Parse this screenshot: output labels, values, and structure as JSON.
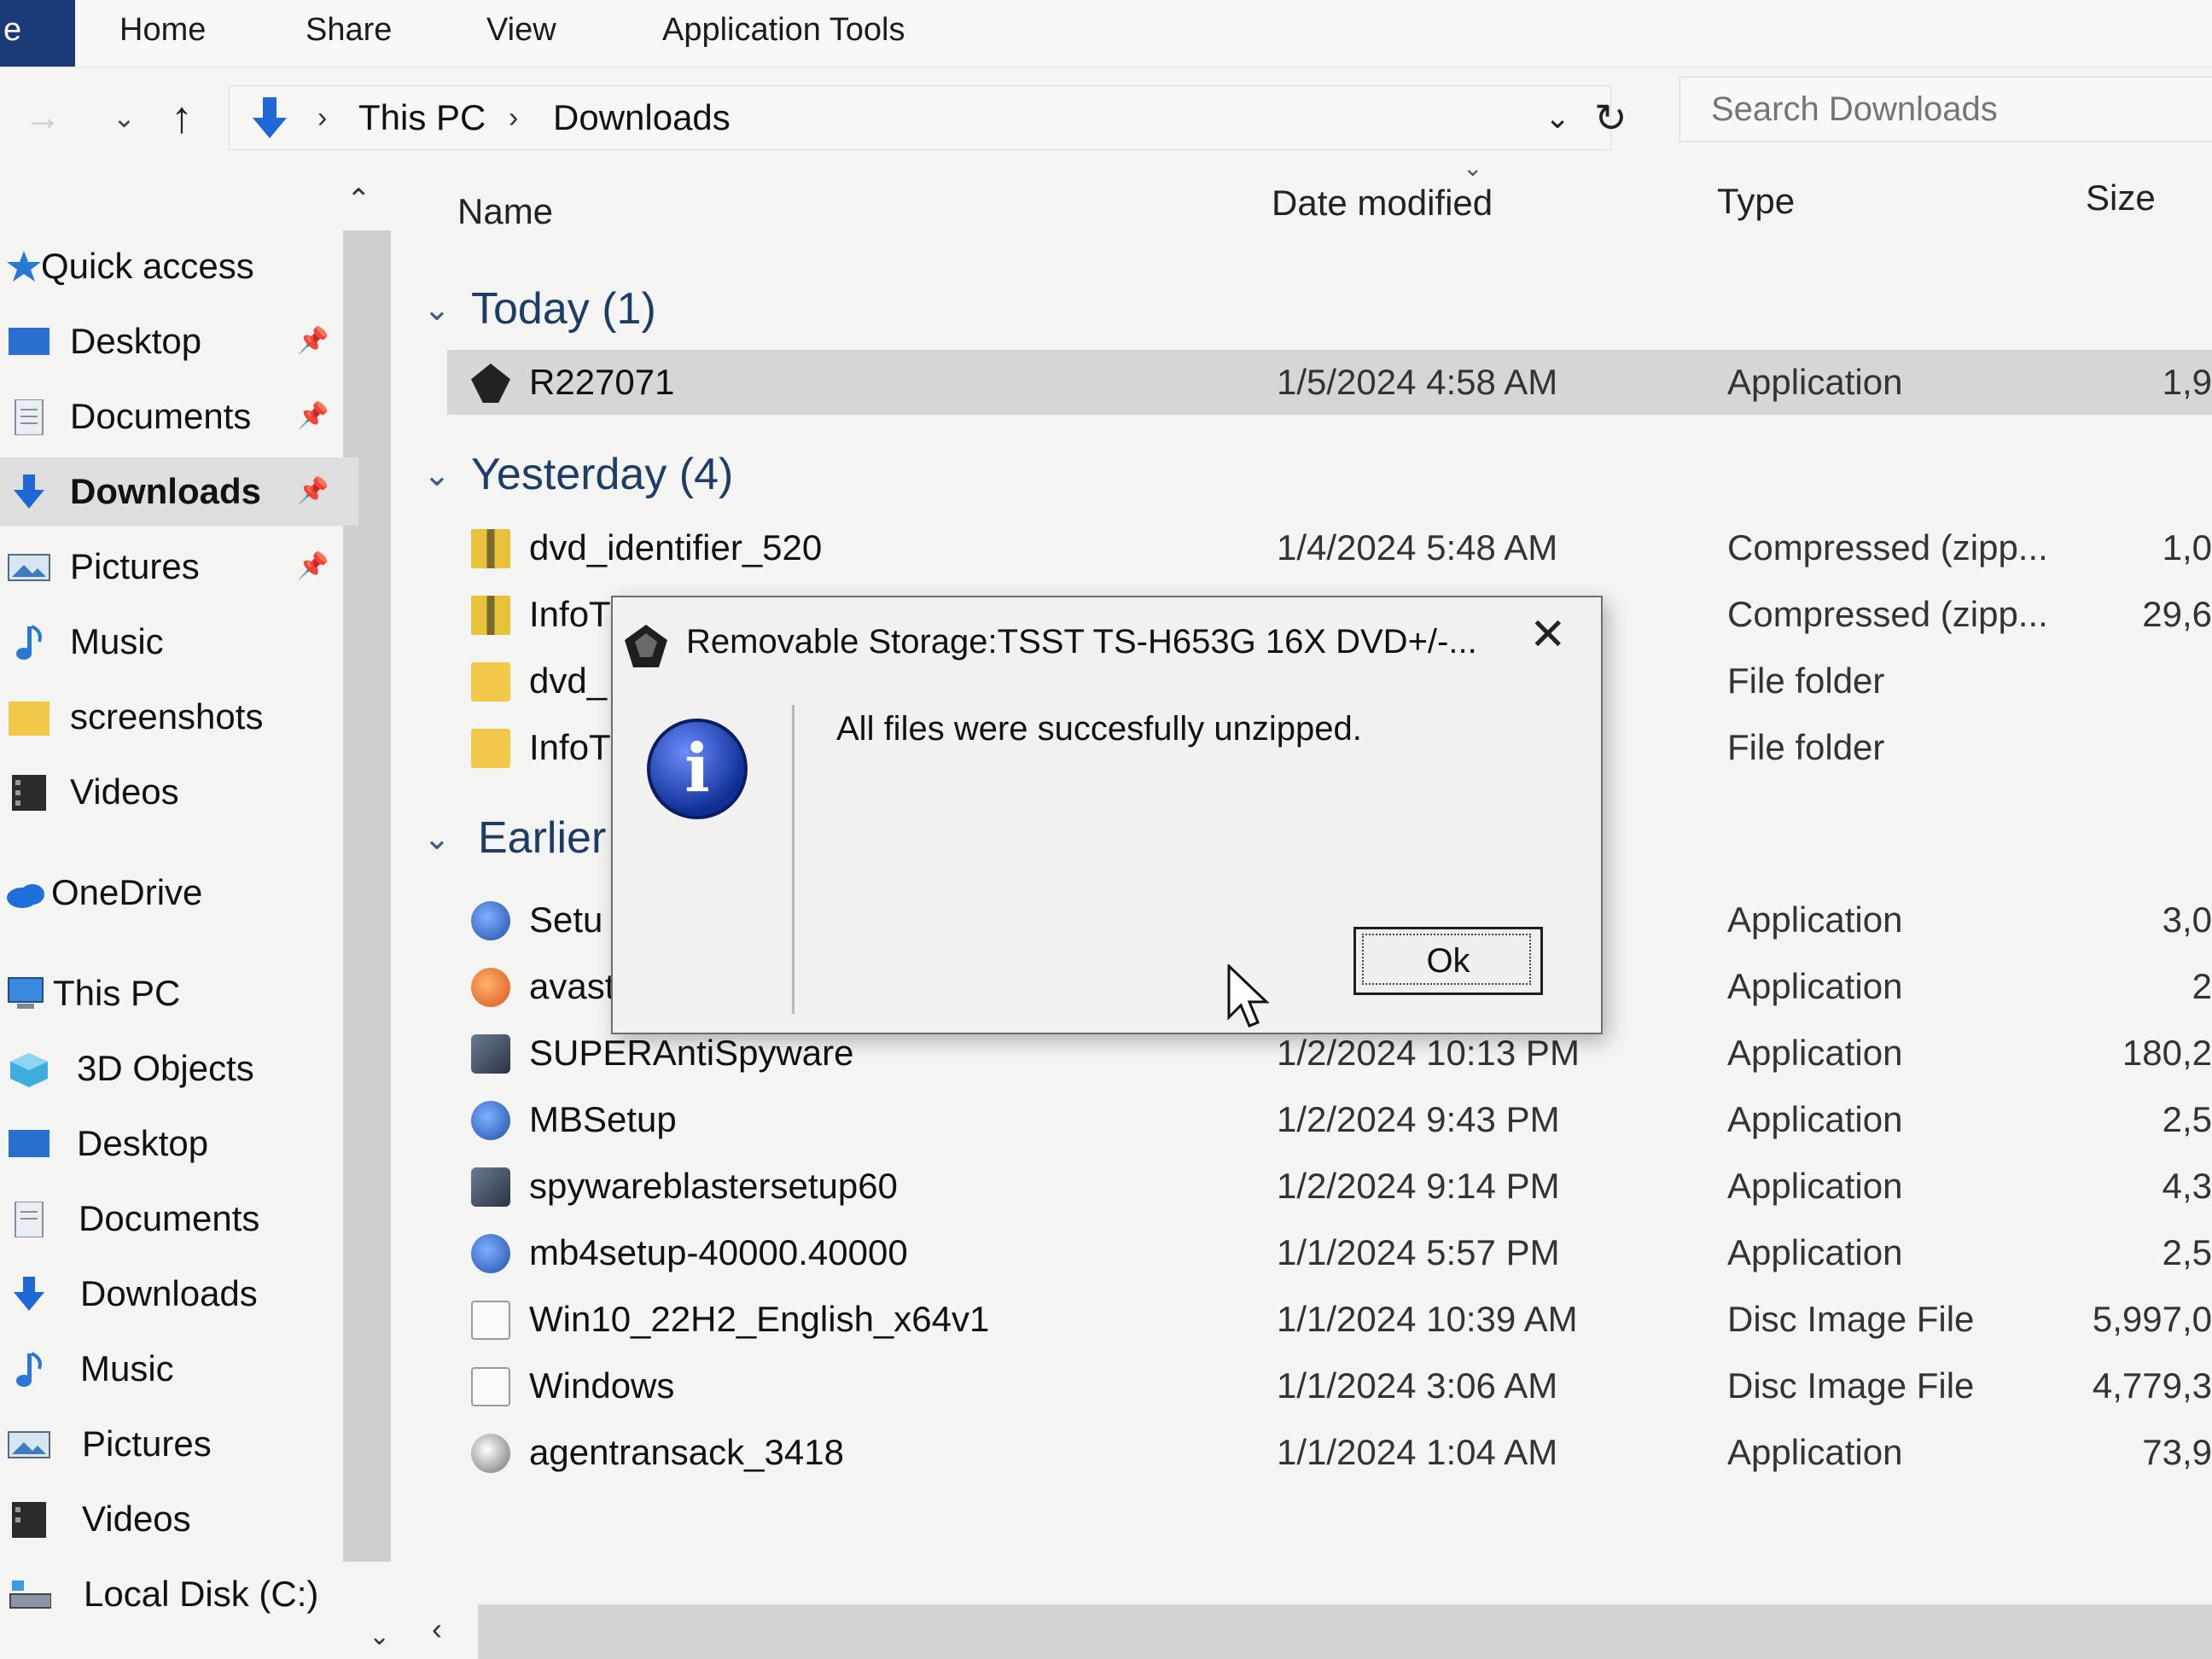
{
  "ribbon": {
    "file_tab": "e",
    "tabs": [
      "Home",
      "Share",
      "View",
      "Application Tools"
    ]
  },
  "address": {
    "breadcrumbs": [
      "This PC",
      "Downloads"
    ],
    "search_placeholder": "Search Downloads"
  },
  "nav": {
    "items": [
      {
        "label": "Quick access",
        "icon": "star-icon"
      },
      {
        "label": "Desktop",
        "icon": "desktop-icon",
        "pinned": true
      },
      {
        "label": "Documents",
        "icon": "documents-icon",
        "pinned": true
      },
      {
        "label": "Downloads",
        "icon": "downloads-icon",
        "pinned": true,
        "selected": true
      },
      {
        "label": "Pictures",
        "icon": "pictures-icon",
        "pinned": true
      },
      {
        "label": "Music",
        "icon": "music-icon"
      },
      {
        "label": "screenshots",
        "icon": "folder-icon"
      },
      {
        "label": "Videos",
        "icon": "videos-icon"
      },
      {
        "label": "OneDrive",
        "icon": "cloud-icon"
      },
      {
        "label": "This PC",
        "icon": "computer-icon"
      },
      {
        "label": "3D Objects",
        "icon": "3d-objects-icon"
      },
      {
        "label": "Desktop",
        "icon": "desktop-icon"
      },
      {
        "label": "Documents",
        "icon": "documents-icon"
      },
      {
        "label": "Downloads",
        "icon": "downloads-icon"
      },
      {
        "label": "Music",
        "icon": "music-icon"
      },
      {
        "label": "Pictures",
        "icon": "pictures-icon"
      },
      {
        "label": "Videos",
        "icon": "videos-icon"
      },
      {
        "label": "Local Disk (C:)",
        "icon": "disk-icon"
      }
    ]
  },
  "columns": {
    "name": "Name",
    "date": "Date modified",
    "type": "Type",
    "size": "Size"
  },
  "groups": {
    "today": "Today (1)",
    "yesterday": "Yesterday (4)",
    "earlier": "Earlier"
  },
  "rows": {
    "today": [
      {
        "name": "R227071",
        "date": "1/5/2024 4:58 AM",
        "type": "Application",
        "size": "1,9",
        "icon": "app-dark-icon"
      }
    ],
    "yesterday": [
      {
        "name": "dvd_identifier_520",
        "date": "1/4/2024 5:48 AM",
        "type": "Compressed (zipp...",
        "size": "1,0",
        "icon": "zip-icon"
      },
      {
        "name": "InfoT",
        "date": "",
        "type": "Compressed (zipp...",
        "size": "29,6",
        "icon": "zip-icon"
      },
      {
        "name": "dvd_",
        "date": "",
        "type": "File folder",
        "size": "",
        "icon": "folder-icon"
      },
      {
        "name": "InfoT",
        "date": "",
        "type": "File folder",
        "size": "",
        "icon": "folder-icon"
      }
    ],
    "earlier": [
      {
        "name": "Setu",
        "date": "",
        "type": "Application",
        "size": "3,0",
        "icon": "app-blue-icon"
      },
      {
        "name": "avast",
        "date": "",
        "type": "Application",
        "size": "2",
        "icon": "app-orange-icon"
      },
      {
        "name": "SUPERAntiSpyware",
        "date": "1/2/2024 10:13 PM",
        "type": "Application",
        "size": "180,2",
        "icon": "installer-icon"
      },
      {
        "name": "MBSetup",
        "date": "1/2/2024 9:43 PM",
        "type": "Application",
        "size": "2,5",
        "icon": "app-blue-icon"
      },
      {
        "name": "spywareblastersetup60",
        "date": "1/2/2024 9:14 PM",
        "type": "Application",
        "size": "4,3",
        "icon": "installer-icon"
      },
      {
        "name": "mb4setup-40000.40000",
        "date": "1/1/2024 5:57 PM",
        "type": "Application",
        "size": "2,5",
        "icon": "app-blue-icon"
      },
      {
        "name": "Win10_22H2_English_x64v1",
        "date": "1/1/2024 10:39 AM",
        "type": "Disc Image File",
        "size": "5,997,0",
        "icon": "disc-image-icon"
      },
      {
        "name": "Windows",
        "date": "1/1/2024 3:06 AM",
        "type": "Disc Image File",
        "size": "4,779,3",
        "icon": "disc-image-icon"
      },
      {
        "name": "agentransack_3418",
        "date": "1/1/2024 1:04 AM",
        "type": "Application",
        "size": "73,9",
        "icon": "search-app-icon"
      }
    ]
  },
  "dialog": {
    "title": "Removable Storage:TSST TS-H653G 16X DVD+/-...",
    "message": "All files were succesfully unzipped.",
    "ok_label": "Ok"
  }
}
